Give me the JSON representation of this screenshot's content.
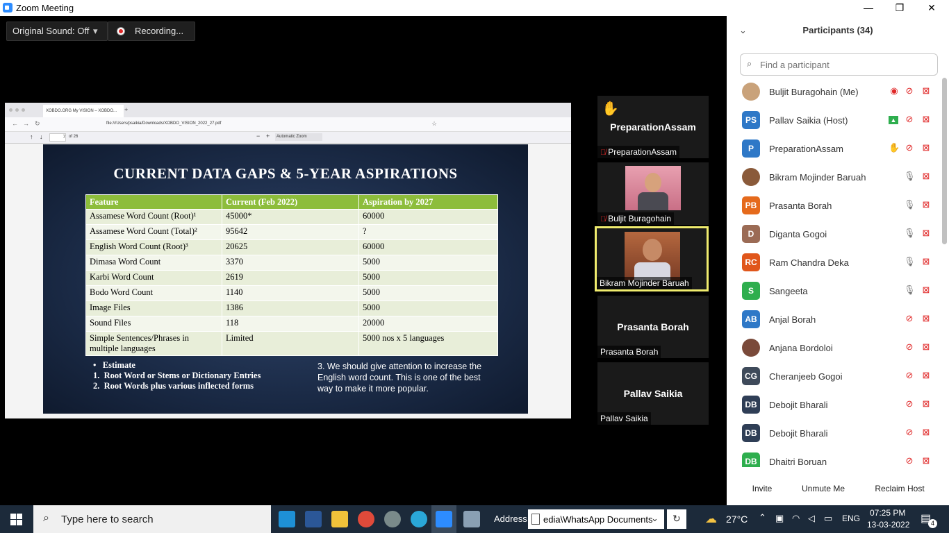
{
  "window": {
    "title": "Zoom Meeting",
    "minimize": "—",
    "restore": "❐",
    "close": "✕"
  },
  "toolbar": {
    "original_sound": "Original Sound: Off",
    "dropdown": "▾",
    "recording": "Recording..."
  },
  "browser": {
    "tab_title": "XOBDO.ORG My VISION – XOBDO...",
    "url": "file:///Users/psaikia/Downloads/XOBDO_VISION_2022_27.pdf",
    "page_num": "7",
    "page_total": "of 26",
    "zoom": "Automatic Zoom"
  },
  "slide": {
    "title": "CURRENT DATA GAPS & 5-YEAR ASPIRATIONS",
    "headers": [
      "Feature",
      "Current (Feb 2022)",
      "Aspiration by 2027"
    ],
    "rows": [
      [
        "Assamese Word Count (Root)¹",
        "45000*",
        "60000"
      ],
      [
        "Assamese Word Count (Total)²",
        "95642",
        "?"
      ],
      [
        "English Word Count (Root)³",
        "20625",
        "60000"
      ],
      [
        "Dimasa Word Count",
        "3370",
        "5000"
      ],
      [
        "Karbi Word Count",
        "2619",
        "5000"
      ],
      [
        "Bodo Word Count",
        "1140",
        "5000"
      ],
      [
        "Image Files",
        "1386",
        "5000"
      ],
      [
        "Sound Files",
        "118",
        "20000"
      ],
      [
        "Simple Sentences/Phrases in multiple languages",
        "Limited",
        "5000 nos x 5 languages"
      ]
    ],
    "notes_left": [
      "•   Estimate",
      "1.  Root Word or Stems or Dictionary Entries",
      "2.  Root Words plus various inflected forms"
    ],
    "note_right": "3. We should give attention to increase the English word count. This is one of the best way to make it more popular."
  },
  "tiles": [
    {
      "big": "PreparationAssam",
      "label": "PreparationAssam",
      "hand": "✋"
    },
    {
      "label": "Buljit Buragohain"
    },
    {
      "label": "Bikram Mojinder Baruah"
    },
    {
      "big": "Prasanta Borah",
      "label": "Prasanta Borah"
    },
    {
      "big": "Pallav Saikia",
      "label": "Pallav Saikia"
    }
  ],
  "panel": {
    "title": "Participants (34)",
    "search_placeholder": "Find a participant",
    "participants": [
      {
        "name": "Buljit Buragohain (Me)",
        "initials": "",
        "color": "#c9a27a"
      },
      {
        "name": "Pallav Saikia (Host)",
        "initials": "PS",
        "color": "#2e78c7"
      },
      {
        "name": "PreparationAssam",
        "initials": "P",
        "color": "#2e78c7"
      },
      {
        "name": "Bikram Mojinder Baruah",
        "initials": "",
        "color": "#8a5a3a"
      },
      {
        "name": "Prasanta Borah",
        "initials": "PB",
        "color": "#e56a1c"
      },
      {
        "name": "Diganta Gogoi",
        "initials": "D",
        "color": "#9b6b55"
      },
      {
        "name": "Ram Chandra Deka",
        "initials": "RC",
        "color": "#e0561b"
      },
      {
        "name": "Sangeeta",
        "initials": "S",
        "color": "#2eae4e"
      },
      {
        "name": "Anjal Borah",
        "initials": "AB",
        "color": "#2e78c7"
      },
      {
        "name": "Anjana Bordoloi",
        "initials": "",
        "color": "#7a4a3a"
      },
      {
        "name": "Cheranjeeb Gogoi",
        "initials": "CG",
        "color": "#3e4a5a"
      },
      {
        "name": "Debojit Bharali",
        "initials": "DB",
        "color": "#2f3e56"
      },
      {
        "name": "Debojit Bharali",
        "initials": "DB",
        "color": "#2f3e56"
      },
      {
        "name": "Dhaitri Boruan",
        "initials": "DB",
        "color": "#2eae4e"
      }
    ],
    "buttons": [
      "Invite",
      "Unmute Me",
      "Reclaim Host"
    ]
  },
  "taskbar": {
    "search_placeholder": "Type here to search",
    "address_label": "Address",
    "address_value": "edia\\WhatsApp Documents",
    "temperature": "27°C",
    "language": "ENG",
    "time": "07:25 PM",
    "date": "13-03-2022",
    "notifications": "4"
  }
}
